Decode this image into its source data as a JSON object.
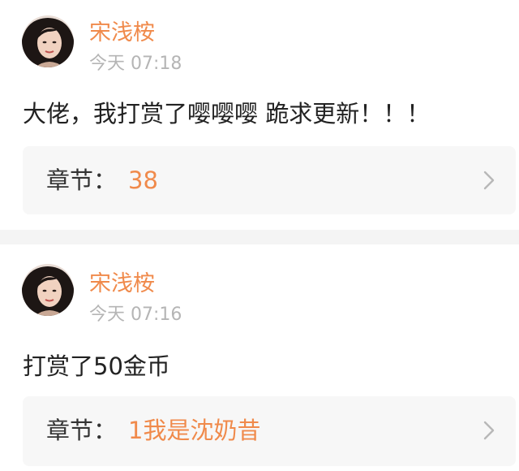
{
  "colors": {
    "accent": "#f08a4b",
    "text": "#222222",
    "muted": "#b5b5b5",
    "card_bg": "#f7f7f7",
    "divider": "#f4f4f4"
  },
  "comments": [
    {
      "username": "宋浅桉",
      "timestamp": "今天 07:18",
      "content": "大佬，我打赏了嘤嘤嘤 跪求更新！！！",
      "chapter_label": "章节：",
      "chapter_value": "38",
      "avatar_icon": "avatar-portrait-icon",
      "chevron_icon": "chevron-right-icon"
    },
    {
      "username": "宋浅桉",
      "timestamp": "今天 07:16",
      "content": "打赏了50金币",
      "chapter_label": "章节：",
      "chapter_value": "1我是沈奶昔",
      "avatar_icon": "avatar-portrait-icon",
      "chevron_icon": "chevron-right-icon"
    }
  ]
}
